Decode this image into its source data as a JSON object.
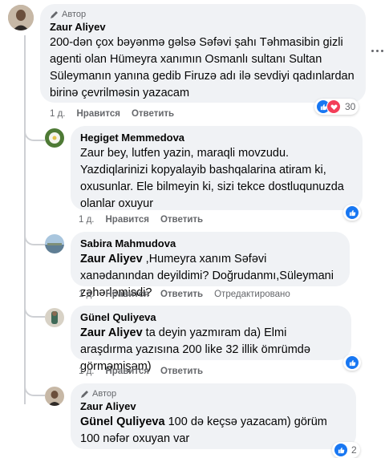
{
  "colors": {
    "bubble": "#f0f2f5",
    "meta": "#65676b",
    "like": "#1877f2",
    "love": "#f33e58",
    "thread": "#ced0d4"
  },
  "comments": [
    {
      "author_badge": "Автор",
      "name": "Zaur Aliyev",
      "text": "200-dən çox bəyənmə gəlsə Səfəvi şahı Təhmasibin gizli agenti olan Hümeyra xanımın Osmanlı sultanı Sultan Süleymanın yanına gedib Firuzə adı ilə sevdiyi qadınlardan birinə çevrilməsin yazacam",
      "time": "1 д.",
      "like_label": "Нравится",
      "reply_label": "Ответить",
      "reaction_count": "30",
      "reactions": [
        "like-icon",
        "love-icon"
      ]
    },
    {
      "name": "Hegiget Memmedova",
      "text": "Zaur bey, lutfen yazin, maraqli movzudu. Yazdiqlarinizi kopyalayib bashqalarina atiram ki, oxusunlar. Ele bilmeyin ki, sizi tekce dostluqunuzda olanlar oxuyur",
      "time": "1 д.",
      "like_label": "Нравится",
      "reply_label": "Ответить",
      "reactions": [
        "like-icon"
      ]
    },
    {
      "name": "Sabira Mahmudova",
      "mention": "Zaur Aliyev",
      "text": " ,Humeyra xanım Səfəvi xanədanından deyildimi? Doğrudanmı,Süleymani zəhərləmisdi?",
      "time": "1 д.",
      "like_label": "Нравится",
      "reply_label": "Ответить",
      "edited_label": "Отредактировано"
    },
    {
      "name": "Günel Quliyeva",
      "mention": "Zaur Aliyev",
      "text": " ta deyin yazmıram da) Elmi araşdırma yazısına 200 like 32 illik ömrümdə görməmişəm)",
      "time": "1 д.",
      "like_label": "Нравится",
      "reply_label": "Ответить",
      "reactions": [
        "like-icon"
      ]
    },
    {
      "author_badge": "Автор",
      "name": "Zaur Aliyev",
      "mention": "Günel Quliyeva",
      "text": " 100 də keçsə yazacam) görüm 100 nəfər oxuyan var",
      "reaction_count": "2",
      "reactions": [
        "like-icon"
      ]
    }
  ]
}
